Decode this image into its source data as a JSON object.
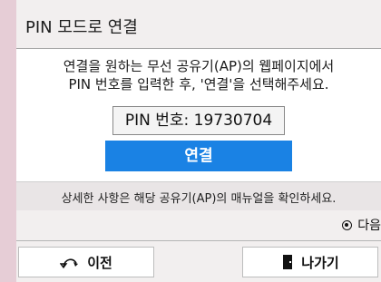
{
  "header": {
    "title": "PIN 모드로 연결"
  },
  "main": {
    "instruction_line1": "연결을 원하는 무선 공유기(AP)의 웹페이지에서",
    "instruction_line2": "PIN 번호를 입력한 후, '연결'을 선택해주세요.",
    "pin_text": "PIN 번호: 19730704",
    "connect_label": "연결"
  },
  "note": {
    "text": "상세한 사항은 해당 공유기(AP)의 매뉴얼을 확인하세요."
  },
  "next": {
    "label": "다음"
  },
  "footer": {
    "prev_label": "이전",
    "exit_label": "나가기"
  },
  "colors": {
    "accent": "#1a82e4",
    "page_background": "#e6cdd6",
    "dialog_background": "#f2efef"
  },
  "icons": {
    "prev": "return-arrow-icon",
    "exit": "door-icon",
    "next": "radio-selected-icon"
  }
}
